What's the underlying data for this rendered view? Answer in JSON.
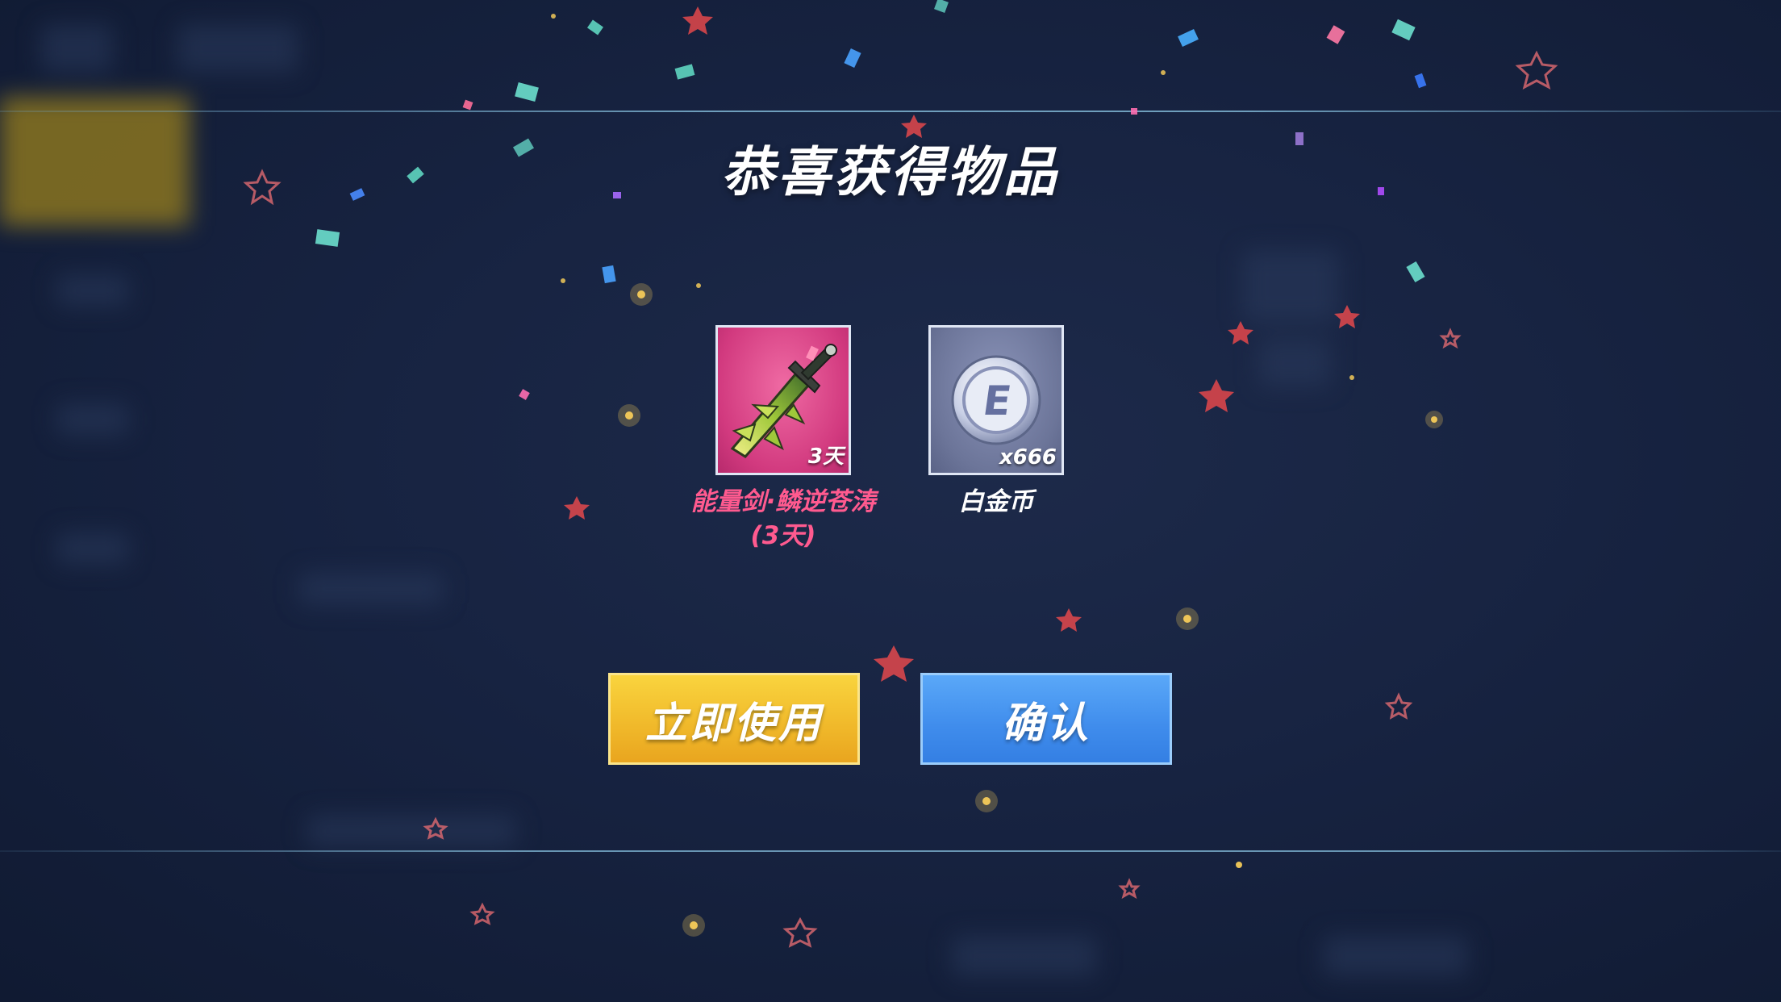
{
  "dialog": {
    "title": "恭喜获得物品",
    "items": [
      {
        "icon": "energy-sword-icon",
        "badge": "3天",
        "name": "能量剑·鳞逆苍涛",
        "name_suffix": "(3天)",
        "name_color": "#ff5a8f"
      },
      {
        "icon": "platinum-coin-icon",
        "badge": "x666",
        "name": "白金币",
        "name_color": "#ffffff"
      }
    ],
    "buttons": {
      "use_now": "立即使用",
      "confirm": "确认"
    }
  },
  "colors": {
    "use_button": "#f0b82a",
    "confirm_button": "#3f8cec",
    "background": "#172341"
  }
}
